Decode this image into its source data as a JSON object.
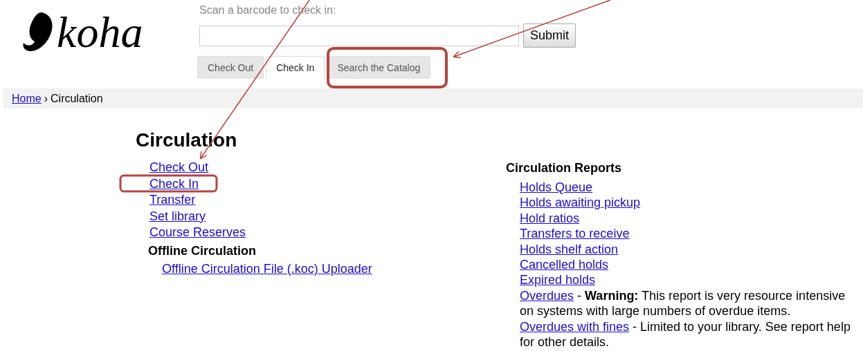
{
  "logo": {
    "text": "koha"
  },
  "checkin_form": {
    "label": "Scan a barcode to check in:",
    "submit": "Submit"
  },
  "tabs": [
    {
      "label": "Check Out",
      "selected": false
    },
    {
      "label": "Check In",
      "selected": true
    },
    {
      "label": "Search the Catalog",
      "selected": false
    }
  ],
  "breadcrumb": {
    "home": "Home",
    "separator": "›",
    "current": "Circulation"
  },
  "title": "Circulation",
  "links": [
    "Check Out",
    "Check In",
    "Transfer",
    "Set library",
    "Course Reserves"
  ],
  "offline": {
    "heading": "Offline Circulation",
    "links": [
      "Offline Circulation File (.koc) Uploader"
    ]
  },
  "reports": {
    "heading": "Circulation Reports",
    "items": [
      {
        "link": "Holds Queue"
      },
      {
        "link": "Holds awaiting pickup"
      },
      {
        "link": "Hold ratios"
      },
      {
        "link": "Transfers to receive"
      },
      {
        "link": "Holds shelf action"
      },
      {
        "link": "Cancelled holds"
      },
      {
        "link": "Expired holds"
      },
      {
        "link": "Overdues",
        "note": "- **Warning:** This report is very resource intensive on systems with large numbers of overdue items."
      },
      {
        "link": "Overdues with fines",
        "note": "- Limited to your library. See report help for other details."
      }
    ]
  }
}
